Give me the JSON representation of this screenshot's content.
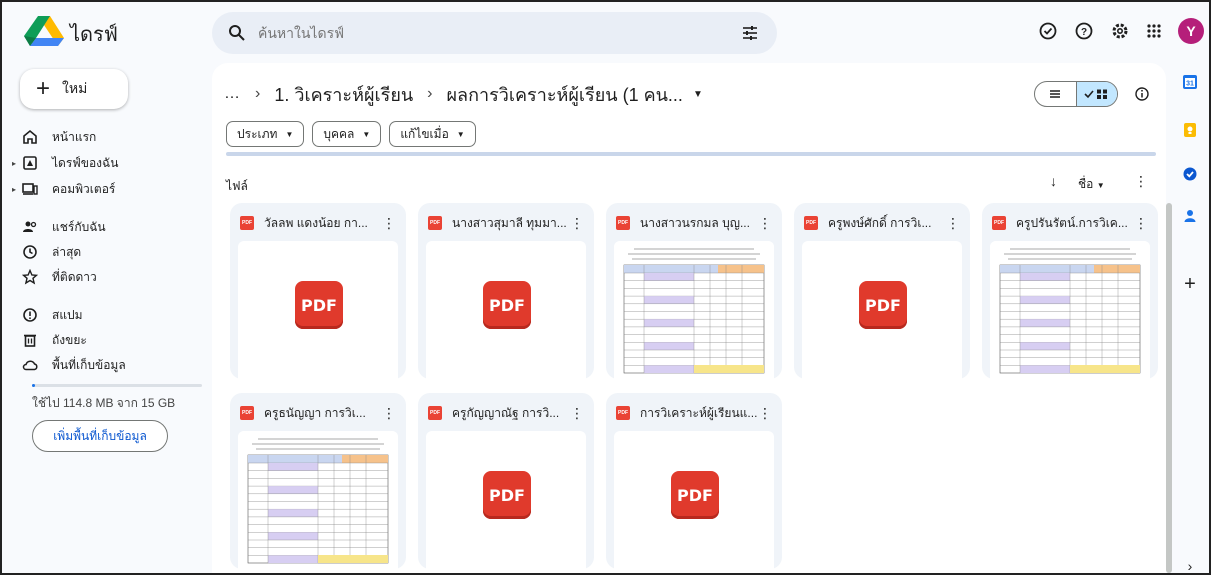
{
  "app": {
    "title": "ไดรฟ์"
  },
  "search": {
    "placeholder": "ค้นหาในไดรฟ์"
  },
  "user": {
    "avatar_letter": "Y",
    "avatar_color": "#b51f7a"
  },
  "sidebar": {
    "new_label": "ใหม่",
    "items": [
      {
        "label": "หน้าแรก",
        "icon": "home-icon"
      },
      {
        "label": "ไดรฟ์ของฉัน",
        "icon": "my-drive-icon"
      },
      {
        "label": "คอมพิวเตอร์",
        "icon": "computer-icon"
      },
      {
        "label": "แชร์กับฉัน",
        "icon": "shared-icon"
      },
      {
        "label": "ล่าสุด",
        "icon": "clock-icon"
      },
      {
        "label": "ที่ติดดาว",
        "icon": "star-icon"
      },
      {
        "label": "สแปม",
        "icon": "spam-icon"
      },
      {
        "label": "ถังขยะ",
        "icon": "trash-icon"
      },
      {
        "label": "พื้นที่เก็บข้อมูล",
        "icon": "cloud-icon"
      }
    ],
    "storage_text": "ใช้ไป 114.8 MB จาก 15 GB",
    "storage_fraction": 0.0075,
    "more_storage_label": "เพิ่มพื้นที่เก็บข้อมูล"
  },
  "breadcrumb": {
    "ellipsis": "…",
    "parent": "1. วิเคราะห์ผู้เรียน",
    "current": "ผลการวิเคราะห์ผู้เรียน (1 คน..."
  },
  "filters": [
    {
      "label": "ประเภท"
    },
    {
      "label": "บุคคล"
    },
    {
      "label": "แก้ไขเมื่อ"
    }
  ],
  "files_section": {
    "label": "ไฟล์",
    "sort_label": "ชื่อ"
  },
  "files": [
    {
      "name": "วัลลพ แดงน้อย กา...",
      "thumb": "pdf"
    },
    {
      "name": "นางสาวสุมาลี ทุมมา...",
      "thumb": "pdf"
    },
    {
      "name": "นางสาวนรกมล บุญ...",
      "thumb": "doc"
    },
    {
      "name": "ครูพงษ์ศักดิ์ การวิเ...",
      "thumb": "pdf"
    },
    {
      "name": "ครูปรันรัตน์.การวิเค...",
      "thumb": "doc"
    },
    {
      "name": "ครูธนัญญา การวิเ...",
      "thumb": "doc"
    },
    {
      "name": "ครูกัญญาณัฐ การวิ...",
      "thumb": "pdf"
    },
    {
      "name": "การวิเคราะห์ผู้เรียนแ...",
      "thumb": "pdf"
    }
  ],
  "pdf_badge": "PDF",
  "pdf_small": "PDF",
  "colors": {
    "accent": "#0b57d0",
    "pdf_red": "#e03a2c",
    "toggle_active": "#c2e7ff"
  }
}
